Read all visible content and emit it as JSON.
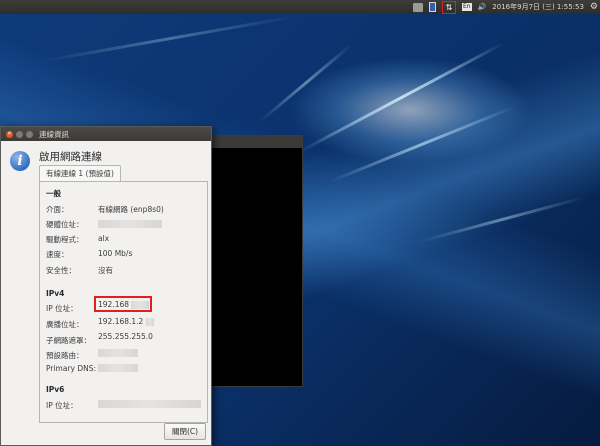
{
  "top_panel": {
    "network_symbol": "⇅",
    "input_method": "En",
    "volume_symbol": "🔊",
    "clock": "2016年9月7日 (三) 1:55:53",
    "gear_symbol": "⚙"
  },
  "dialog": {
    "title": "連線資訊",
    "heading": "啟用網路連線",
    "tab_label": "有線連線 1 (預設值)",
    "info_icon_glyph": "i",
    "close_button_label": "關閉(C)",
    "sections": {
      "general": "一般",
      "ipv4": "IPv4",
      "ipv6": "IPv6"
    },
    "general": {
      "interface_label": "介面：",
      "interface_value": "有線網路 (enp8s0)",
      "hw_label": "硬體位址：",
      "driver_label": "驅動程式：",
      "driver_value": "alx",
      "speed_label": "速度：",
      "speed_value": "100 Mb/s",
      "security_label": "安全性：",
      "security_value": "沒有"
    },
    "ipv4": {
      "ip_label": "IP 位址：",
      "ip_value": "192.168",
      "broadcast_label": "廣播位址：",
      "broadcast_value": "192.168.1.2",
      "subnet_label": "子網路遮罩：",
      "subnet_value": "255.255.255.0",
      "gateway_label": "預設路由：",
      "dns_label": "Primary DNS:"
    },
    "ipv6": {
      "ip_label": "IP 位址："
    }
  }
}
